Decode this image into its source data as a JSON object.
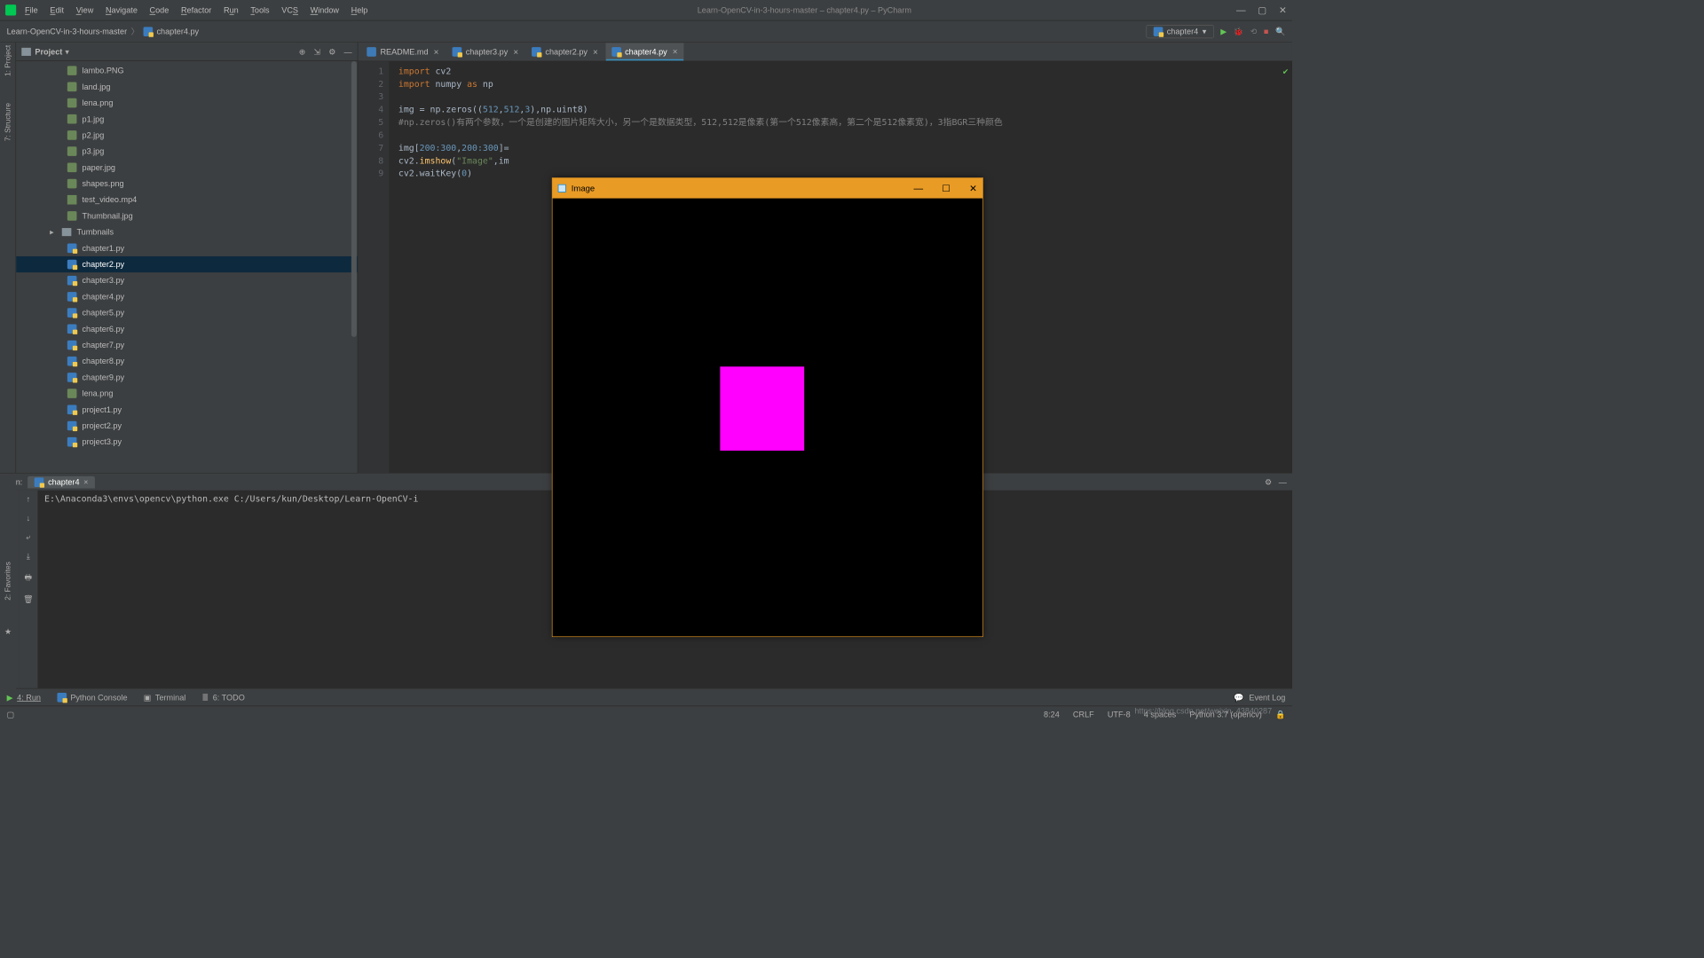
{
  "window": {
    "title": "Learn-OpenCV-in-3-hours-master – chapter4.py – PyCharm"
  },
  "menu": {
    "file": "File",
    "edit": "Edit",
    "view": "View",
    "navigate": "Navigate",
    "code": "Code",
    "refactor": "Refactor",
    "run": "Run",
    "tools": "Tools",
    "vcs": "VCS",
    "window": "Window",
    "help": "Help"
  },
  "breadcrumb": {
    "root": "Learn-OpenCV-in-3-hours-master",
    "file": "chapter4.py"
  },
  "toolbar": {
    "config": "chapter4"
  },
  "project": {
    "title": "Project",
    "items": [
      {
        "name": "lambo.PNG",
        "type": "img"
      },
      {
        "name": "land.jpg",
        "type": "img"
      },
      {
        "name": "lena.png",
        "type": "img"
      },
      {
        "name": "p1.jpg",
        "type": "img"
      },
      {
        "name": "p2.jpg",
        "type": "img"
      },
      {
        "name": "p3.jpg",
        "type": "img"
      },
      {
        "name": "paper.jpg",
        "type": "img"
      },
      {
        "name": "shapes.png",
        "type": "img"
      },
      {
        "name": "test_video.mp4",
        "type": "vid"
      },
      {
        "name": "Thumbnail.jpg",
        "type": "img"
      },
      {
        "name": "Tumbnails",
        "type": "folder",
        "expandable": true
      },
      {
        "name": "chapter1.py",
        "type": "py"
      },
      {
        "name": "chapter2.py",
        "type": "py",
        "selected": true
      },
      {
        "name": "chapter3.py",
        "type": "py"
      },
      {
        "name": "chapter4.py",
        "type": "py"
      },
      {
        "name": "chapter5.py",
        "type": "py"
      },
      {
        "name": "chapter6.py",
        "type": "py"
      },
      {
        "name": "chapter7.py",
        "type": "py"
      },
      {
        "name": "chapter8.py",
        "type": "py"
      },
      {
        "name": "chapter9.py",
        "type": "py"
      },
      {
        "name": "lena.png",
        "type": "img"
      },
      {
        "name": "project1.py",
        "type": "py"
      },
      {
        "name": "project2.py",
        "type": "py"
      },
      {
        "name": "project3.py",
        "type": "py"
      }
    ]
  },
  "tabs": [
    {
      "label": "README.md",
      "type": "md"
    },
    {
      "label": "chapter3.py",
      "type": "py"
    },
    {
      "label": "chapter2.py",
      "type": "py"
    },
    {
      "label": "chapter4.py",
      "type": "py",
      "active": true
    }
  ],
  "code": {
    "lines": [
      1,
      2,
      3,
      4,
      5,
      6,
      7,
      8,
      9
    ],
    "l1": {
      "a": "import",
      "b": " cv2"
    },
    "l2": {
      "a": "import",
      "b": " numpy ",
      "c": "as",
      "d": " np"
    },
    "l4a": "img = np.zeros((",
    "l4n1": "512",
    "l4c": ",",
    "l4n2": "512",
    "l4n3": "3",
    "l4b": "),np.uint8)",
    "l5": "#np.zeros()有两个参数，一个是创建的图片矩阵大小，另一个是数据类型，512,512是像素(第一个512像素高，第二个是512像素宽)，3指BGR三种颜色",
    "l7a": "img[",
    "l7n1": "200",
    "l7c": ":",
    "l7n2": "300",
    "l7n3": "200",
    "l7n4": "300",
    "l7b": "]=",
    "l8a": "cv2.imshow",
    "l8p": "(",
    "l8s": "\"Image\"",
    "l8b": ",im",
    "l9a": "cv2.waitKey(",
    "l9n": "0",
    "l9b": ")"
  },
  "cvwin": {
    "title": "Image"
  },
  "run": {
    "label": "Run:",
    "tab": "chapter4",
    "output": "E:\\Anaconda3\\envs\\opencv\\python.exe C:/Users/kun/Desktop/Learn-OpenCV-i"
  },
  "bottom": {
    "run": "4: Run",
    "console": "Python Console",
    "terminal": "Terminal",
    "todo": "6: TODO",
    "eventlog": "Event Log"
  },
  "status": {
    "pos": "8:24",
    "eol": "CRLF",
    "enc": "UTF-8",
    "indent": "4 spaces",
    "python": "Python 3.7 (opencv)",
    "lock": "🔒"
  },
  "sidebar": {
    "project": "1: Project",
    "structure": "7: Structure",
    "favorites": "2: Favorites"
  },
  "watermark": "https://blog.csdn.net/weixin_43840287"
}
